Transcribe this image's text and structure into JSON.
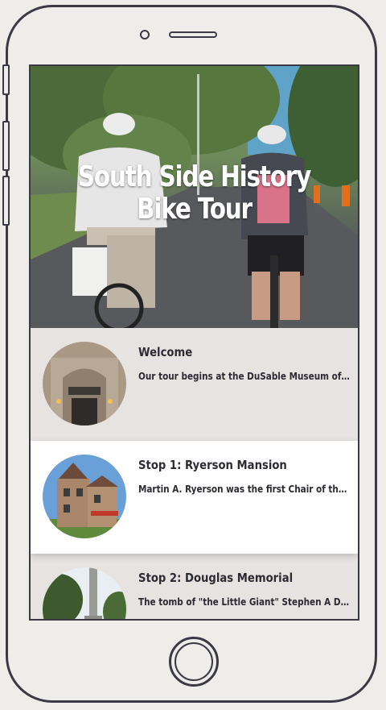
{
  "hero": {
    "title_line1": "South Side History",
    "title_line2": "Bike Tour"
  },
  "stops": [
    {
      "title": "Welcome",
      "description": "Our tour begins at the DuSable Museum of Afri...",
      "image": "museum-entrance"
    },
    {
      "title": "Stop 1: Ryerson Mansion",
      "description": "Martin A. Ryerson was the first Chair of the Un...",
      "image": "victorian-mansion"
    },
    {
      "title": "Stop 2: Douglas Memorial",
      "description": "The tomb of \"the Little Giant\" Stephen A Doug...",
      "image": "memorial-column"
    }
  ],
  "colors": {
    "frame": "#3a3a44",
    "background": "#efedea",
    "row_background": "#e6e3e0",
    "active_row_background": "#ffffff",
    "text": "#2c2b33"
  }
}
